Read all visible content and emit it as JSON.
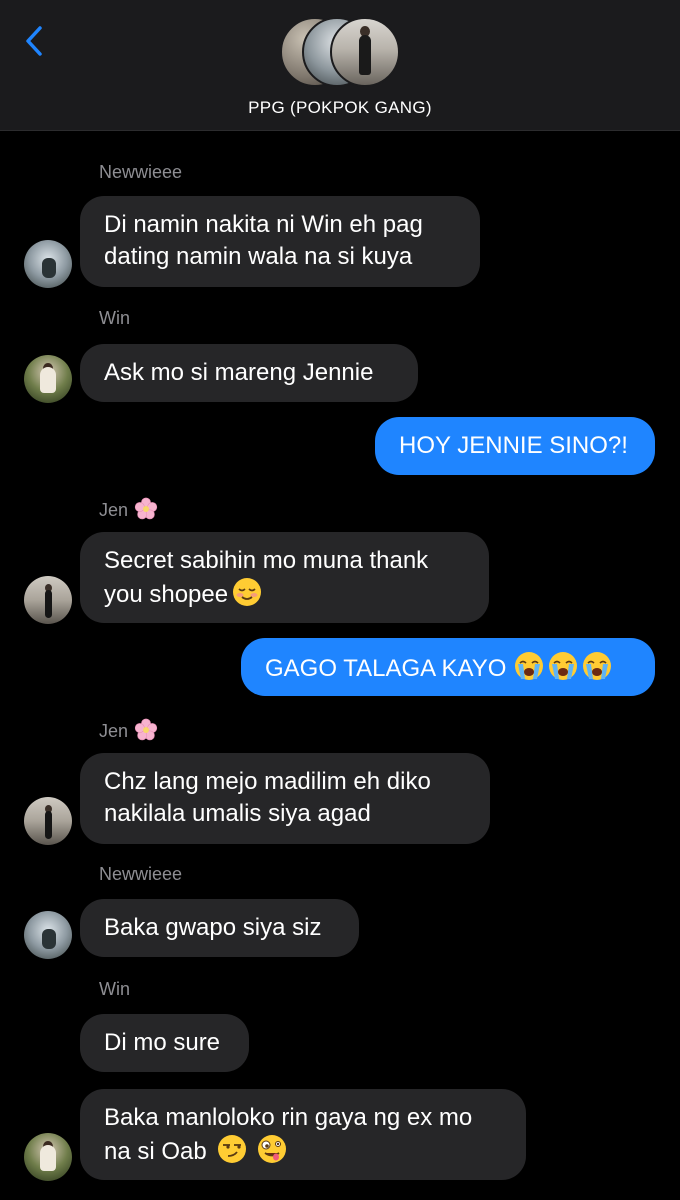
{
  "header": {
    "group_name": "PPG (POKPOK GANG)",
    "back_icon": "chevron-left-icon",
    "accent_color": "#1f85ff"
  },
  "messages": [
    {
      "sender": "Newwieee",
      "text": "Di namin nakita ni Win eh pag dating namin wala na si kuya"
    },
    {
      "sender": "Win",
      "text": "Ask mo si mareng Jennie"
    },
    {
      "sender": "me",
      "text": "HOY JENNIE SINO?!"
    },
    {
      "sender": "Jen",
      "sender_emoji": "cherry-blossom-icon",
      "text": "Secret sabihin mo muna thank you shopee",
      "emojis": [
        "smiling-face-icon"
      ]
    },
    {
      "sender": "me",
      "text": "GAGO TALAGA KAYO",
      "emojis": [
        "loudly-crying-face-icon",
        "loudly-crying-face-icon",
        "loudly-crying-face-icon"
      ]
    },
    {
      "sender": "Jen",
      "sender_emoji": "cherry-blossom-icon",
      "text": "Chz lang mejo madilim eh diko nakilala umalis siya agad"
    },
    {
      "sender": "Newwieee",
      "text": "Baka gwapo siya siz"
    },
    {
      "sender": "Win",
      "text": "Di mo sure"
    },
    {
      "sender": "Win",
      "text": "Baka manloloko rin gaya ng ex mo na si Oab",
      "emojis": [
        "smirking-face-icon",
        "zany-face-icon"
      ]
    }
  ],
  "colors": {
    "incoming_bubble": "#262628",
    "outgoing_bubble": "#1f85ff",
    "background": "#000000",
    "sender_label": "#8e8e93"
  }
}
